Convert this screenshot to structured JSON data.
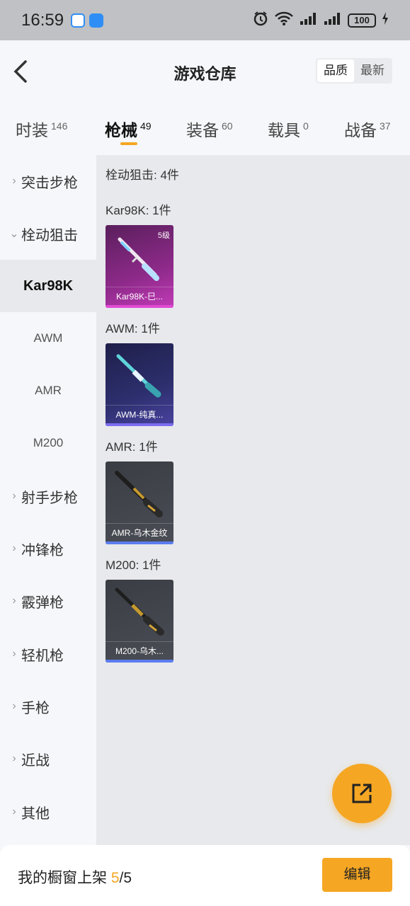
{
  "status": {
    "time": "16:59",
    "battery": "100"
  },
  "header": {
    "title": "游戏仓库",
    "sort": [
      "品质",
      "最新"
    ]
  },
  "tabs": [
    {
      "label": "时装",
      "count": "146"
    },
    {
      "label": "枪械",
      "count": "49"
    },
    {
      "label": "装备",
      "count": "60"
    },
    {
      "label": "载具",
      "count": "0"
    },
    {
      "label": "战备",
      "count": "37"
    }
  ],
  "sidebar": {
    "items": [
      {
        "label": "突击步枪"
      },
      {
        "label": "栓动狙击"
      },
      {
        "label": "Kar98K"
      },
      {
        "label": "AWM"
      },
      {
        "label": "AMR"
      },
      {
        "label": "M200"
      },
      {
        "label": "射手步枪"
      },
      {
        "label": "冲锋枪"
      },
      {
        "label": "霰弹枪"
      },
      {
        "label": "轻机枪"
      },
      {
        "label": "手枪"
      },
      {
        "label": "近战"
      },
      {
        "label": "其他"
      }
    ]
  },
  "content": {
    "summary": "栓动狙击: 4件",
    "groups": [
      {
        "title": "Kar98K: 1件",
        "item": {
          "name": "Kar98K-巳...",
          "level": "5级",
          "rarity": "#c23bb7"
        }
      },
      {
        "title": "AWM: 1件",
        "item": {
          "name": "AWM-纯真...",
          "rarity": "#4a43a0"
        }
      },
      {
        "title": "AMR: 1件",
        "item": {
          "name": "AMR-乌木金纹",
          "rarity": "#4a4d55"
        }
      },
      {
        "title": "M200: 1件",
        "item": {
          "name": "M200-乌木...",
          "rarity": "#4a4d55"
        }
      }
    ]
  },
  "bottom": {
    "label": "我的橱窗上架",
    "current": "5",
    "total": "/5",
    "edit": "编辑"
  },
  "colors": {
    "accent": "#f5a623"
  }
}
